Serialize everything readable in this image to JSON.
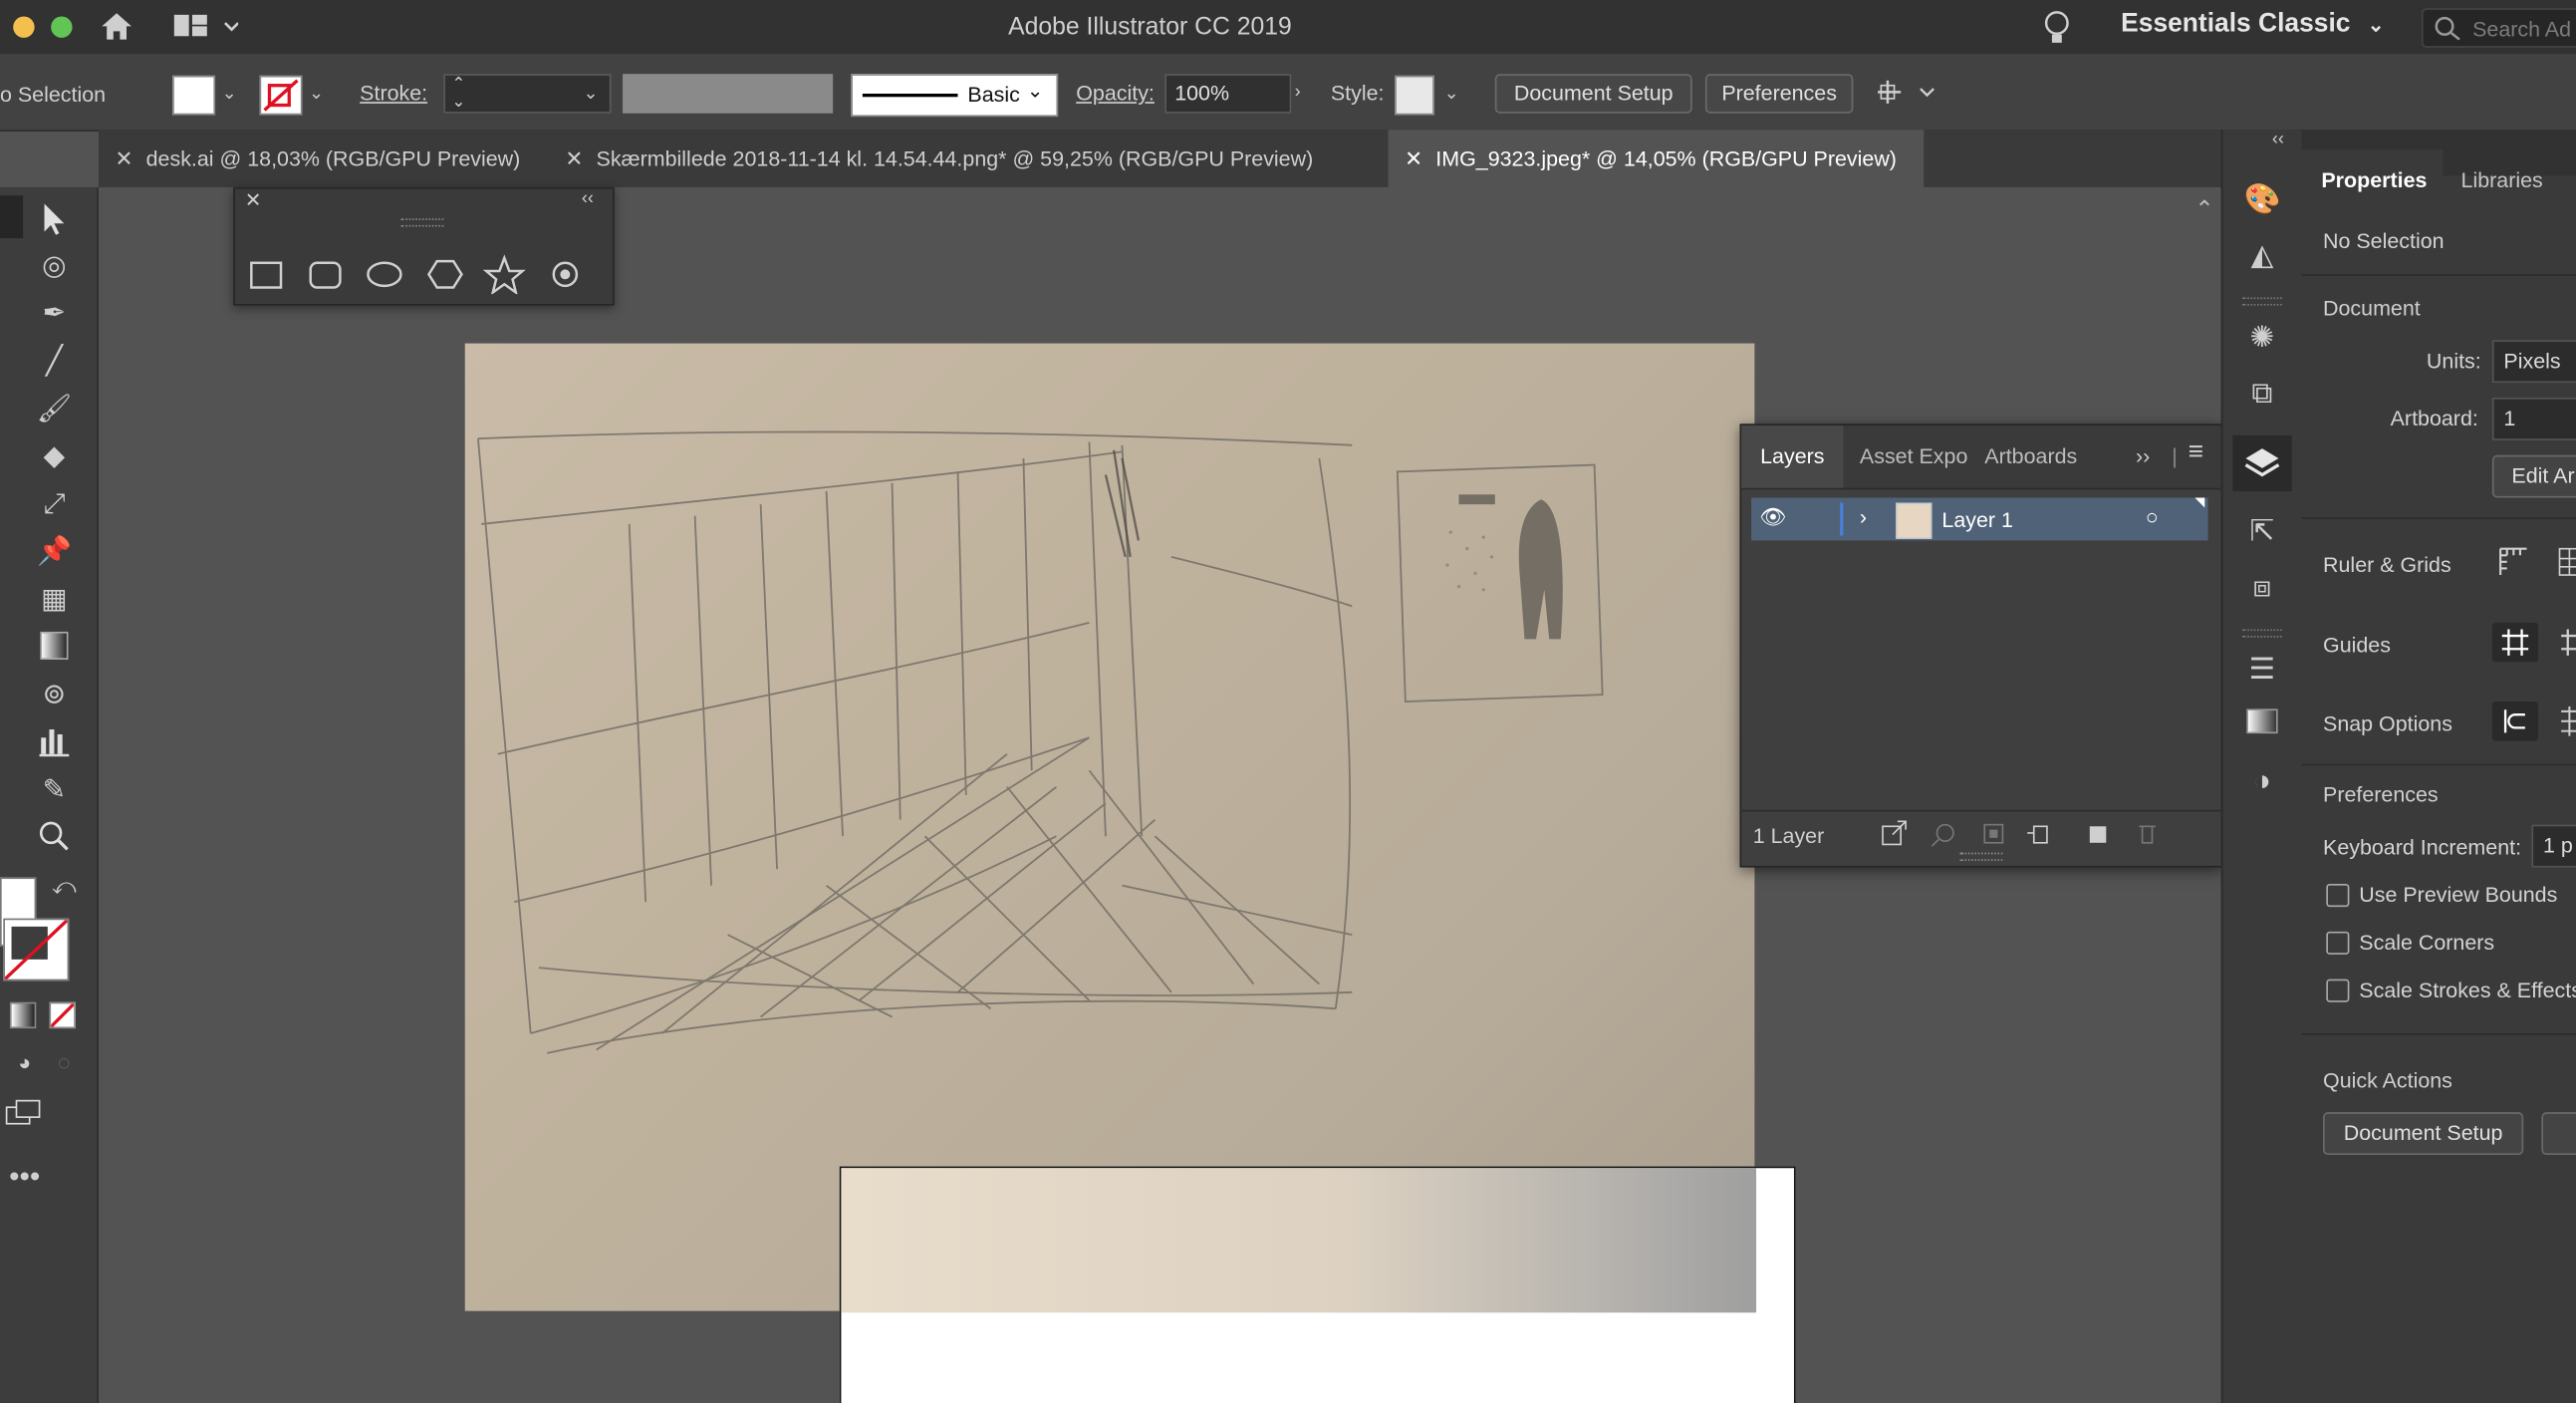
{
  "window": {
    "title": "Adobe Illustrator CC 2019",
    "workspace": "Essentials Classic",
    "search_placeholder": "Search Ad"
  },
  "controlbar": {
    "selection_label": "o Selection",
    "stroke_label": "Stroke:",
    "brush_label": "Basic",
    "opacity_label": "Opacity:",
    "opacity_value": "100%",
    "style_label": "Style:",
    "document_setup": "Document Setup",
    "preferences": "Preferences"
  },
  "tabs": [
    {
      "label": "desk.ai @ 18,03% (RGB/GPU Preview)",
      "active": false
    },
    {
      "label": "Skærmbillede 2018-11-14 kl. 14.54.44.png* @ 59,25% (RGB/GPU Preview)",
      "active": false
    },
    {
      "label": "IMG_9323.jpeg* @ 14,05% (RGB/GPU Preview)",
      "active": true
    }
  ],
  "layers_panel": {
    "tabs": [
      "Layers",
      "Asset Expo",
      "Artboards"
    ],
    "layer_name": "Layer 1",
    "footer_count": "1 Layer"
  },
  "properties": {
    "tabs": [
      "Properties",
      "Libraries"
    ],
    "no_selection": "No Selection",
    "document_heading": "Document",
    "units_label": "Units:",
    "units_value": "Pixels",
    "artboard_label": "Artboard:",
    "artboard_value": "1",
    "edit_artboards": "Edit Ar",
    "ruler_grids": "Ruler & Grids",
    "guides": "Guides",
    "snap_options": "Snap Options",
    "preferences_heading": "Preferences",
    "keyboard_increment_label": "Keyboard Increment:",
    "keyboard_increment_value": "1 p",
    "use_preview_bounds": "Use Preview Bounds",
    "scale_corners": "Scale Corners",
    "scale_strokes": "Scale Strokes & Effects",
    "quick_actions": "Quick Actions",
    "document_setup_button": "Document Setup"
  },
  "colors": {
    "layer_highlight": "#4f6277",
    "accent_blue": "#4a7fd8"
  }
}
